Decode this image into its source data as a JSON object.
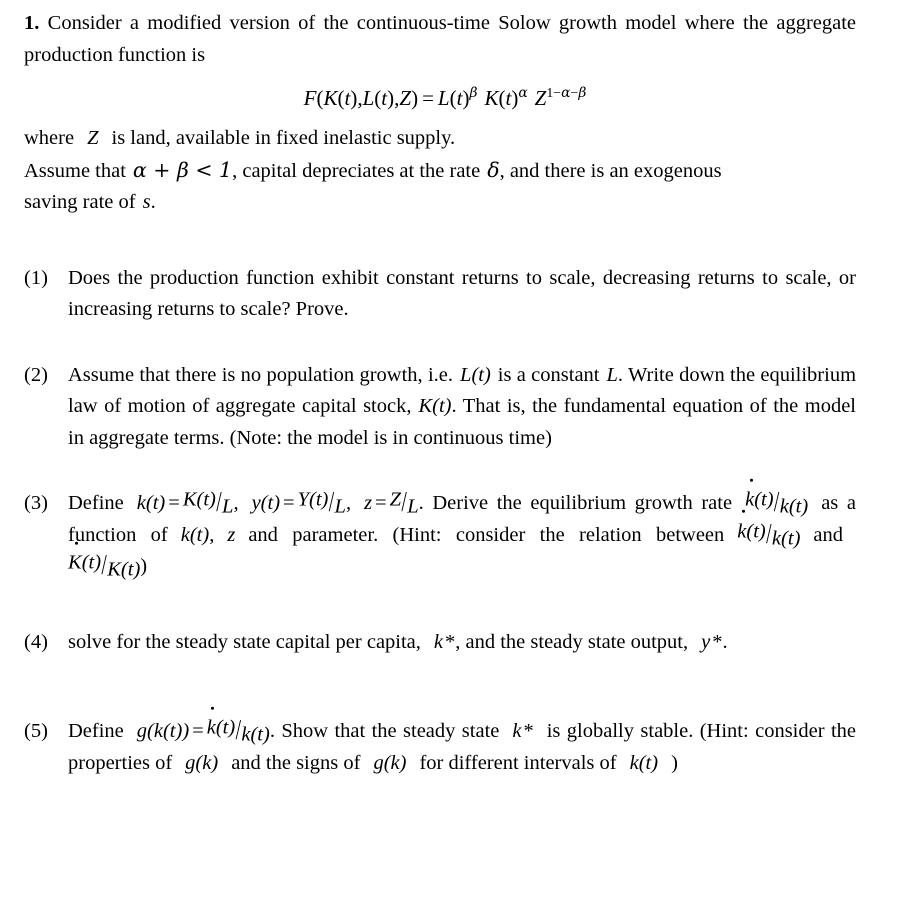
{
  "document": {
    "problem_number": "1.",
    "intro": {
      "line1": "Consider a modified version of the continuous-time Solow growth model where the",
      "line2": "aggregate production function is"
    },
    "equation": {
      "lhs_F": "F",
      "lhs_args": "(K(t), L(t), Z)",
      "equals": "=",
      "rhs": "L(t)^β K(t)^α Z^(1−α−β)",
      "F": "F",
      "K": "K",
      "L": "L",
      "Z": "Z",
      "t": "t",
      "alpha": "α",
      "beta": "β",
      "one": "1",
      "minus": "−",
      "open_paren": "(",
      "close_paren": ")",
      "comma": ","
    },
    "where_line": {
      "pre": "where",
      "symbol": "Z",
      "post": "is land, available in fixed inelastic supply."
    },
    "assume_line": {
      "pre": "Assume that",
      "condition": "α + β < 1",
      "mid": ", capital depreciates at the rate",
      "delta": "δ",
      "post": ", and there is an exogenous",
      "line2_pre": "saving rate of",
      "line2_symbol": "s",
      "line2_post": "."
    },
    "questions": [
      {
        "number": "(1)",
        "text": "Does the production function exhibit constant returns to scale, decreasing returns to scale, or increasing returns to scale? Prove."
      },
      {
        "number": "(2)",
        "text": "Assume that there is no population growth, i.e. L(t) is a constant L . Write down the equilibrium law of motion of aggregate capital stock, K(t). That is, the fundamental equation of the model in aggregate terms. (Note: the model is in continuous time)",
        "parts": {
          "p1": "Assume that there is no population growth, i.e.",
          "Lt": "L(t)",
          "p2": "is a constant",
          "L": "L",
          "p3": ". Write down the equilibrium law of motion of aggregate capital stock,",
          "Kt": "K(t)",
          "p4": ". That is, the fundamental equation of the model in aggregate terms. (Note: the model is in continuous time)"
        }
      },
      {
        "number": "(3)",
        "text": "Define k(t) = K(t)/L , y(t) = Y(t)/L , z = Z/L . Derive the equilibrium growth rate k̇(t)/k(t) as a function of k(t), z and parameter. (Hint: consider the relation between k̇(t)/k(t) and K̇(t)/K(t))",
        "parts": {
          "define": "Define",
          "def1": "k(t) = K(t)/L",
          "def2": "y(t) = Y(t)/L",
          "def3": "z = Z/L",
          "p1": ". Derive the equilibrium growth rate",
          "ratio1": "k̇(t)/k(t)",
          "p2": "as a function of",
          "kt": "k(t)",
          "z": "z",
          "p3": "and parameter. (Hint: consider the relation between",
          "ratio2": "k̇(t)/k(t)",
          "and": "and",
          "ratio3": "K̇(t)/K(t)",
          "close": ")"
        }
      },
      {
        "number": "(4)",
        "text": "solve for the steady state capital per capita, k*, and the steady state output, y*.",
        "parts": {
          "p1": "solve for the steady state capital per capita,",
          "kstar": "k*",
          "p2": ", and the steady state output,",
          "ystar": "y*",
          "p3": "."
        }
      },
      {
        "number": "(5)",
        "text": "Define g(k(t)) = k̇(t)/k(t). Show that the steady state k* is globally stable. (Hint: consider the properties of g(k) and the signs of g(k) for different intervals of k(t) )",
        "parts": {
          "define": "Define",
          "gdef": "g(k(t)) = k̇(t)/k(t)",
          "p1": ". Show that the steady state",
          "kstar": "k*",
          "p2": "is globally stable. (Hint: consider the properties of",
          "gk1": "g(k)",
          "p3": "and the signs of",
          "gk2": "g(k)",
          "p4": "for different intervals of",
          "kt": "k(t)",
          "close": ")"
        }
      }
    ],
    "colors": {
      "background": "#ffffff",
      "text": "#000000"
    }
  }
}
